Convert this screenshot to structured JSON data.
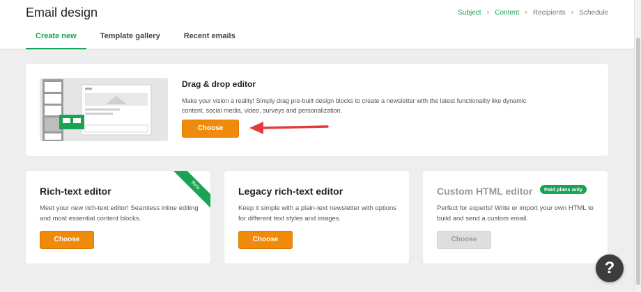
{
  "header": {
    "title": "Email design",
    "steps": [
      {
        "label": "Subject",
        "done": true
      },
      {
        "label": "Content",
        "done": true
      },
      {
        "label": "Recipients",
        "done": false
      },
      {
        "label": "Schedule",
        "done": false
      }
    ],
    "tabs": [
      {
        "label": "Create new",
        "active": true
      },
      {
        "label": "Template gallery",
        "active": false
      },
      {
        "label": "Recent emails",
        "active": false
      }
    ]
  },
  "dnd_card": {
    "title": "Drag & drop editor",
    "description": "Make your vision a reality! Simply drag pre-built design blocks to create a newsletter with the latest functionality like dynamic content, social media, video, surveys and personalization.",
    "button_label": "Choose"
  },
  "rich_card": {
    "title": "Rich-text editor",
    "ribbon": "Beta",
    "description": "Meet your new rich-text editor! Seamless inline editing and most essential content blocks.",
    "button_label": "Choose"
  },
  "legacy_card": {
    "title": "Legacy rich-text editor",
    "description": "Keep it simple with a plain-text newsletter with options for different text styles and images.",
    "button_label": "Choose"
  },
  "html_card": {
    "title": "Custom HTML editor",
    "badge": "Paid plans only",
    "description": "Perfect for experts! Write or import your own HTML to build and send a custom email.",
    "button_label": "Choose",
    "button_disabled": true
  },
  "help": {
    "label": "?"
  },
  "colors": {
    "accent_green": "#1aa352",
    "button_orange": "#f08a0a",
    "arrow_red": "#e53a3a",
    "background": "#eeeeee"
  },
  "icons": {
    "help": "question-mark-icon",
    "arrow": "left-arrow-annotation",
    "step_separator": "chevron-right-icon"
  }
}
